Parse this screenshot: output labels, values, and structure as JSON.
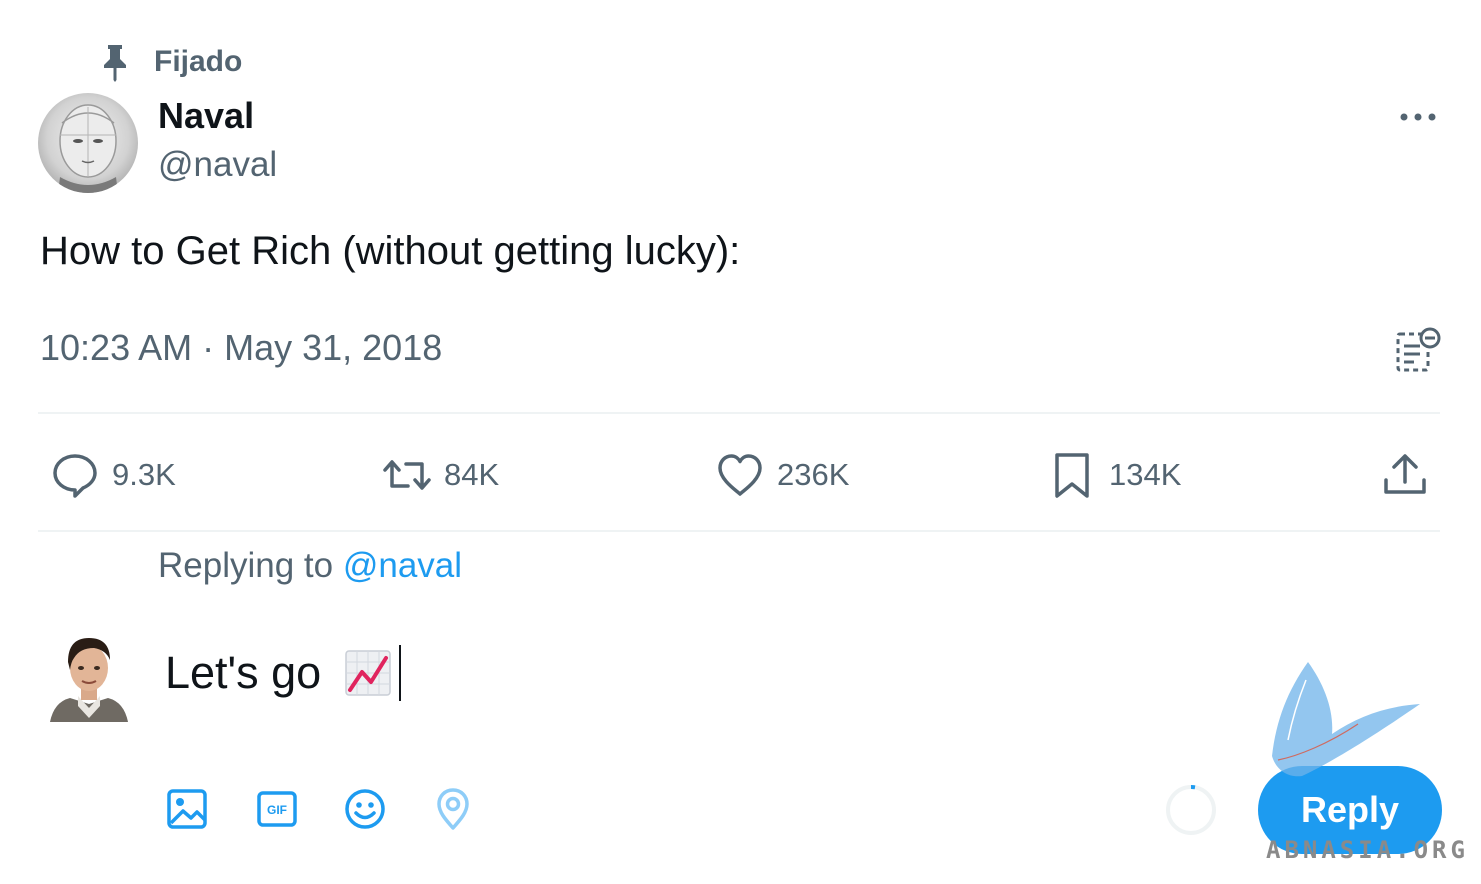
{
  "pinned": {
    "label": "Fijado",
    "icon": "pin-icon"
  },
  "tweet": {
    "author_name": "Naval",
    "author_handle": "@naval",
    "text": "How to Get Rich (without getting lucky):",
    "timestamp": "10:23 AM · May 31, 2018"
  },
  "actions": {
    "replies": "9.3K",
    "retweets": "84K",
    "likes": "236K",
    "bookmarks": "134K"
  },
  "composer": {
    "replying_prefix": "Replying to ",
    "replying_mention": "@naval",
    "draft_text": "Let's go",
    "draft_emoji": "chart-increasing-emoji",
    "toolbar_icons": [
      "image-icon",
      "gif-icon",
      "emoji-icon",
      "location-icon"
    ],
    "reply_label": "Reply"
  },
  "watermark": {
    "text": "ABNASIA.ORG"
  },
  "colors": {
    "accent": "#1d9bf0",
    "text_primary": "#0f1419",
    "text_secondary": "#536471",
    "divider": "#eff3f4"
  }
}
